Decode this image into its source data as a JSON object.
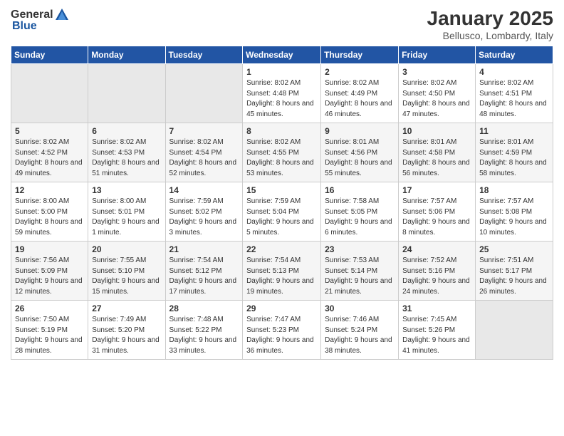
{
  "header": {
    "logo_general": "General",
    "logo_blue": "Blue",
    "title": "January 2025",
    "subtitle": "Bellusco, Lombardy, Italy"
  },
  "calendar": {
    "days_of_week": [
      "Sunday",
      "Monday",
      "Tuesday",
      "Wednesday",
      "Thursday",
      "Friday",
      "Saturday"
    ],
    "weeks": [
      [
        {
          "day": "",
          "empty": true
        },
        {
          "day": "",
          "empty": true
        },
        {
          "day": "",
          "empty": true
        },
        {
          "day": "1",
          "sunrise": "8:02 AM",
          "sunset": "4:48 PM",
          "daylight": "8 hours and 45 minutes."
        },
        {
          "day": "2",
          "sunrise": "8:02 AM",
          "sunset": "4:49 PM",
          "daylight": "8 hours and 46 minutes."
        },
        {
          "day": "3",
          "sunrise": "8:02 AM",
          "sunset": "4:50 PM",
          "daylight": "8 hours and 47 minutes."
        },
        {
          "day": "4",
          "sunrise": "8:02 AM",
          "sunset": "4:51 PM",
          "daylight": "8 hours and 48 minutes."
        }
      ],
      [
        {
          "day": "5",
          "sunrise": "8:02 AM",
          "sunset": "4:52 PM",
          "daylight": "8 hours and 49 minutes."
        },
        {
          "day": "6",
          "sunrise": "8:02 AM",
          "sunset": "4:53 PM",
          "daylight": "8 hours and 51 minutes."
        },
        {
          "day": "7",
          "sunrise": "8:02 AM",
          "sunset": "4:54 PM",
          "daylight": "8 hours and 52 minutes."
        },
        {
          "day": "8",
          "sunrise": "8:02 AM",
          "sunset": "4:55 PM",
          "daylight": "8 hours and 53 minutes."
        },
        {
          "day": "9",
          "sunrise": "8:01 AM",
          "sunset": "4:56 PM",
          "daylight": "8 hours and 55 minutes."
        },
        {
          "day": "10",
          "sunrise": "8:01 AM",
          "sunset": "4:58 PM",
          "daylight": "8 hours and 56 minutes."
        },
        {
          "day": "11",
          "sunrise": "8:01 AM",
          "sunset": "4:59 PM",
          "daylight": "8 hours and 58 minutes."
        }
      ],
      [
        {
          "day": "12",
          "sunrise": "8:00 AM",
          "sunset": "5:00 PM",
          "daylight": "8 hours and 59 minutes."
        },
        {
          "day": "13",
          "sunrise": "8:00 AM",
          "sunset": "5:01 PM",
          "daylight": "9 hours and 1 minute."
        },
        {
          "day": "14",
          "sunrise": "7:59 AM",
          "sunset": "5:02 PM",
          "daylight": "9 hours and 3 minutes."
        },
        {
          "day": "15",
          "sunrise": "7:59 AM",
          "sunset": "5:04 PM",
          "daylight": "9 hours and 5 minutes."
        },
        {
          "day": "16",
          "sunrise": "7:58 AM",
          "sunset": "5:05 PM",
          "daylight": "9 hours and 6 minutes."
        },
        {
          "day": "17",
          "sunrise": "7:57 AM",
          "sunset": "5:06 PM",
          "daylight": "9 hours and 8 minutes."
        },
        {
          "day": "18",
          "sunrise": "7:57 AM",
          "sunset": "5:08 PM",
          "daylight": "9 hours and 10 minutes."
        }
      ],
      [
        {
          "day": "19",
          "sunrise": "7:56 AM",
          "sunset": "5:09 PM",
          "daylight": "9 hours and 12 minutes."
        },
        {
          "day": "20",
          "sunrise": "7:55 AM",
          "sunset": "5:10 PM",
          "daylight": "9 hours and 15 minutes."
        },
        {
          "day": "21",
          "sunrise": "7:54 AM",
          "sunset": "5:12 PM",
          "daylight": "9 hours and 17 minutes."
        },
        {
          "day": "22",
          "sunrise": "7:54 AM",
          "sunset": "5:13 PM",
          "daylight": "9 hours and 19 minutes."
        },
        {
          "day": "23",
          "sunrise": "7:53 AM",
          "sunset": "5:14 PM",
          "daylight": "9 hours and 21 minutes."
        },
        {
          "day": "24",
          "sunrise": "7:52 AM",
          "sunset": "5:16 PM",
          "daylight": "9 hours and 24 minutes."
        },
        {
          "day": "25",
          "sunrise": "7:51 AM",
          "sunset": "5:17 PM",
          "daylight": "9 hours and 26 minutes."
        }
      ],
      [
        {
          "day": "26",
          "sunrise": "7:50 AM",
          "sunset": "5:19 PM",
          "daylight": "9 hours and 28 minutes."
        },
        {
          "day": "27",
          "sunrise": "7:49 AM",
          "sunset": "5:20 PM",
          "daylight": "9 hours and 31 minutes."
        },
        {
          "day": "28",
          "sunrise": "7:48 AM",
          "sunset": "5:22 PM",
          "daylight": "9 hours and 33 minutes."
        },
        {
          "day": "29",
          "sunrise": "7:47 AM",
          "sunset": "5:23 PM",
          "daylight": "9 hours and 36 minutes."
        },
        {
          "day": "30",
          "sunrise": "7:46 AM",
          "sunset": "5:24 PM",
          "daylight": "9 hours and 38 minutes."
        },
        {
          "day": "31",
          "sunrise": "7:45 AM",
          "sunset": "5:26 PM",
          "daylight": "9 hours and 41 minutes."
        },
        {
          "day": "",
          "empty": true
        }
      ]
    ]
  }
}
